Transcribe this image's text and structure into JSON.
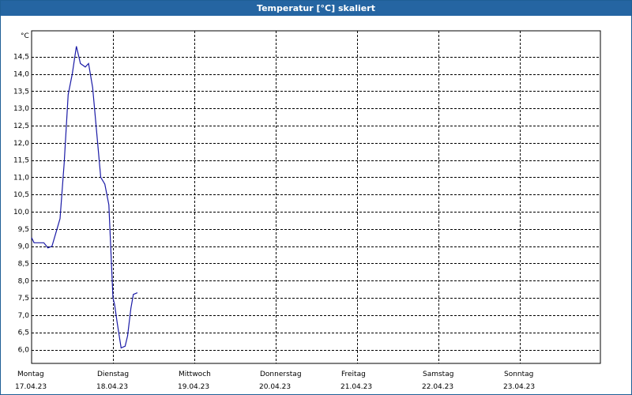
{
  "window": {
    "title": "Temperatur [°C] skaliert"
  },
  "colors": {
    "titlebar": "#2565a2",
    "series": "#1a1aa6",
    "grid": "#000000"
  },
  "chart_data": {
    "type": "line",
    "title": "Temperatur [°C] skaliert",
    "ylabel": "°C",
    "xlabel": "",
    "ylim": [
      5.6,
      15.25
    ],
    "y_ticks": [
      "6,0",
      "6,5",
      "7,0",
      "7,5",
      "8,0",
      "8,5",
      "9,0",
      "9,5",
      "10,0",
      "10,5",
      "11,0",
      "11,5",
      "12,0",
      "12,5",
      "13,0",
      "13,5",
      "14,0",
      "14,5"
    ],
    "y_tick_values": [
      6.0,
      6.5,
      7.0,
      7.5,
      8.0,
      8.5,
      9.0,
      9.5,
      10.0,
      10.5,
      11.0,
      11.5,
      12.0,
      12.5,
      13.0,
      13.5,
      14.0,
      14.5
    ],
    "grid": true,
    "x_range_days": [
      0,
      7
    ],
    "x_ticks": [
      {
        "day": "Montag",
        "date": "17.04.23"
      },
      {
        "day": "Dienstag",
        "date": "18.04.23"
      },
      {
        "day": "Mittwoch",
        "date": "19.04.23"
      },
      {
        "day": "Donnerstag",
        "date": "20.04.23"
      },
      {
        "day": "Freitag",
        "date": "21.04.23"
      },
      {
        "day": "Samstag",
        "date": "22.04.23"
      },
      {
        "day": "Sonntag",
        "date": "23.04.23"
      }
    ],
    "series": [
      {
        "x": [
          0.0,
          0.03,
          0.06,
          0.1,
          0.15,
          0.2,
          0.25,
          0.3,
          0.35,
          0.4,
          0.45,
          0.5,
          0.55,
          0.6,
          0.63,
          0.66,
          0.7,
          0.75,
          0.8,
          0.85,
          0.9,
          0.95,
          1.0,
          1.02,
          1.05,
          1.1,
          1.15,
          1.18,
          1.2,
          1.22,
          1.25,
          1.3
        ],
        "values": [
          9.25,
          9.1,
          9.1,
          9.1,
          9.1,
          8.95,
          9.0,
          9.4,
          9.8,
          11.4,
          13.4,
          14.0,
          14.8,
          14.3,
          14.25,
          14.2,
          14.3,
          13.6,
          12.3,
          11.0,
          10.8,
          10.2,
          7.5,
          7.3,
          6.8,
          6.05,
          6.1,
          6.4,
          6.8,
          7.2,
          7.6,
          7.65
        ]
      }
    ]
  }
}
